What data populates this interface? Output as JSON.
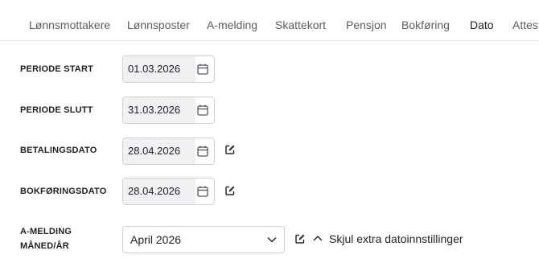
{
  "tabs": [
    {
      "label": "Lønnsmottakere",
      "active": false
    },
    {
      "label": "Lønnsposter",
      "active": false
    },
    {
      "label": "A-melding",
      "active": false
    },
    {
      "label": "Skattekort",
      "active": false
    },
    {
      "label": "Pensjon",
      "active": false
    },
    {
      "label": "Bokføring",
      "active": false
    },
    {
      "label": "Dato",
      "active": true
    },
    {
      "label": "Attest",
      "active": false
    }
  ],
  "fields": {
    "periode_start": {
      "label": "PERIODE START",
      "value": "01.03.2026",
      "icon": "calendar-icon"
    },
    "periode_slutt": {
      "label": "PERIODE SLUTT",
      "value": "31.03.2026",
      "icon": "calendar-icon"
    },
    "betalingsdato": {
      "label": "BETALINGSDATO",
      "value": "28.04.2026",
      "icon": "calendar-icon",
      "edit_icon": "edit-icon"
    },
    "bokforingsdato": {
      "label": "BOKFØRINGSDATO",
      "value": "28.04.2026",
      "icon": "calendar-icon",
      "edit_icon": "edit-icon"
    },
    "amelding_maned": {
      "label_line1": "A-MELDING",
      "label_line2": "MÅNED/ÅR",
      "value": "April 2026",
      "icon": "chevron-down-icon",
      "edit_icon": "edit-icon"
    }
  },
  "toggle": {
    "label": "Skjul extra datoinnstillinger",
    "icon": "chevron-up-icon"
  },
  "colors": {
    "active_tab_underline": "#3b3b82",
    "field_fill": "#f1f1f4",
    "border": "#cfd0d6"
  }
}
